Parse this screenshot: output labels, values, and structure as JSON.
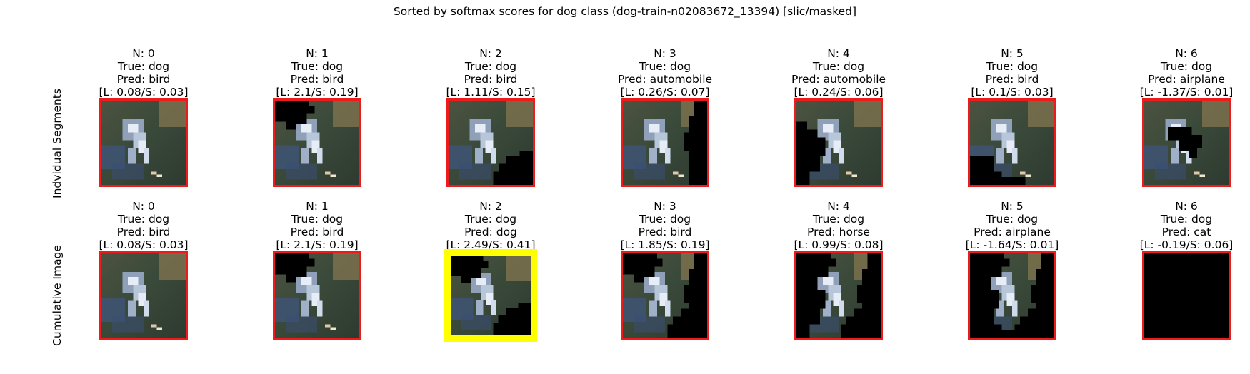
{
  "figure": {
    "title": "Sorted by softmax scores for dog class (dog-train-n02083672_13394) [slic/masked]",
    "row_labels": [
      "Indvidual Segments",
      "Cumulative Image"
    ],
    "colors": {
      "frame": "#ec1c1c",
      "highlight_frame": "#ffff00",
      "mask": "#000000"
    },
    "rows": [
      {
        "name": "individual",
        "panels": [
          {
            "n": "N: 0",
            "true": "True: dog",
            "pred": "Pred: bird",
            "scores": "[L: 0.08/S: 0.03]",
            "highlight": false,
            "masked": []
          },
          {
            "n": "N: 1",
            "true": "True: dog",
            "pred": "Pred: bird",
            "scores": "[L: 2.1/S: 0.19]",
            "highlight": false,
            "masked": [
              "topleft"
            ]
          },
          {
            "n": "N: 2",
            "true": "True: dog",
            "pred": "Pred: bird",
            "scores": "[L: 1.11/S: 0.15]",
            "highlight": false,
            "masked": [
              "bottomright"
            ]
          },
          {
            "n": "N: 3",
            "true": "True: dog",
            "pred": "Pred: automobile",
            "scores": "[L: 0.26/S: 0.07]",
            "highlight": false,
            "masked": [
              "right"
            ]
          },
          {
            "n": "N: 4",
            "true": "True: dog",
            "pred": "Pred: automobile",
            "scores": "[L: 0.24/S: 0.06]",
            "highlight": false,
            "masked": [
              "left"
            ]
          },
          {
            "n": "N: 5",
            "true": "True: dog",
            "pred": "Pred: bird",
            "scores": "[L: 0.1/S: 0.03]",
            "highlight": false,
            "masked": [
              "bottom"
            ]
          },
          {
            "n": "N: 6",
            "true": "True: dog",
            "pred": "Pred: airplane",
            "scores": "[L: -1.37/S: 0.01]",
            "highlight": false,
            "masked": [
              "center"
            ]
          }
        ]
      },
      {
        "name": "cumulative",
        "panels": [
          {
            "n": "N: 0",
            "true": "True: dog",
            "pred": "Pred: bird",
            "scores": "[L: 0.08/S: 0.03]",
            "highlight": false,
            "masked": []
          },
          {
            "n": "N: 1",
            "true": "True: dog",
            "pred": "Pred: bird",
            "scores": "[L: 2.1/S: 0.19]",
            "highlight": false,
            "masked": [
              "topleft"
            ]
          },
          {
            "n": "N: 2",
            "true": "True: dog",
            "pred": "Pred: dog",
            "scores": "[L: 2.49/S: 0.41]",
            "highlight": true,
            "masked": [
              "topleft",
              "bottomright"
            ]
          },
          {
            "n": "N: 3",
            "true": "True: dog",
            "pred": "Pred: bird",
            "scores": "[L: 1.85/S: 0.19]",
            "highlight": false,
            "masked": [
              "topleft",
              "bottomright",
              "right"
            ]
          },
          {
            "n": "N: 4",
            "true": "True: dog",
            "pred": "Pred: horse",
            "scores": "[L: 0.99/S: 0.08]",
            "highlight": false,
            "masked": [
              "topleft",
              "bottomright",
              "right",
              "left"
            ]
          },
          {
            "n": "N: 5",
            "true": "True: dog",
            "pred": "Pred: airplane",
            "scores": "[L: -1.64/S: 0.01]",
            "highlight": false,
            "masked": [
              "topleft",
              "bottomright",
              "right",
              "left",
              "bottom"
            ]
          },
          {
            "n": "N: 6",
            "true": "True: dog",
            "pred": "Pred: cat",
            "scores": "[L: -0.19/S: 0.06]",
            "highlight": false,
            "masked": [
              "all"
            ]
          }
        ]
      }
    ]
  }
}
